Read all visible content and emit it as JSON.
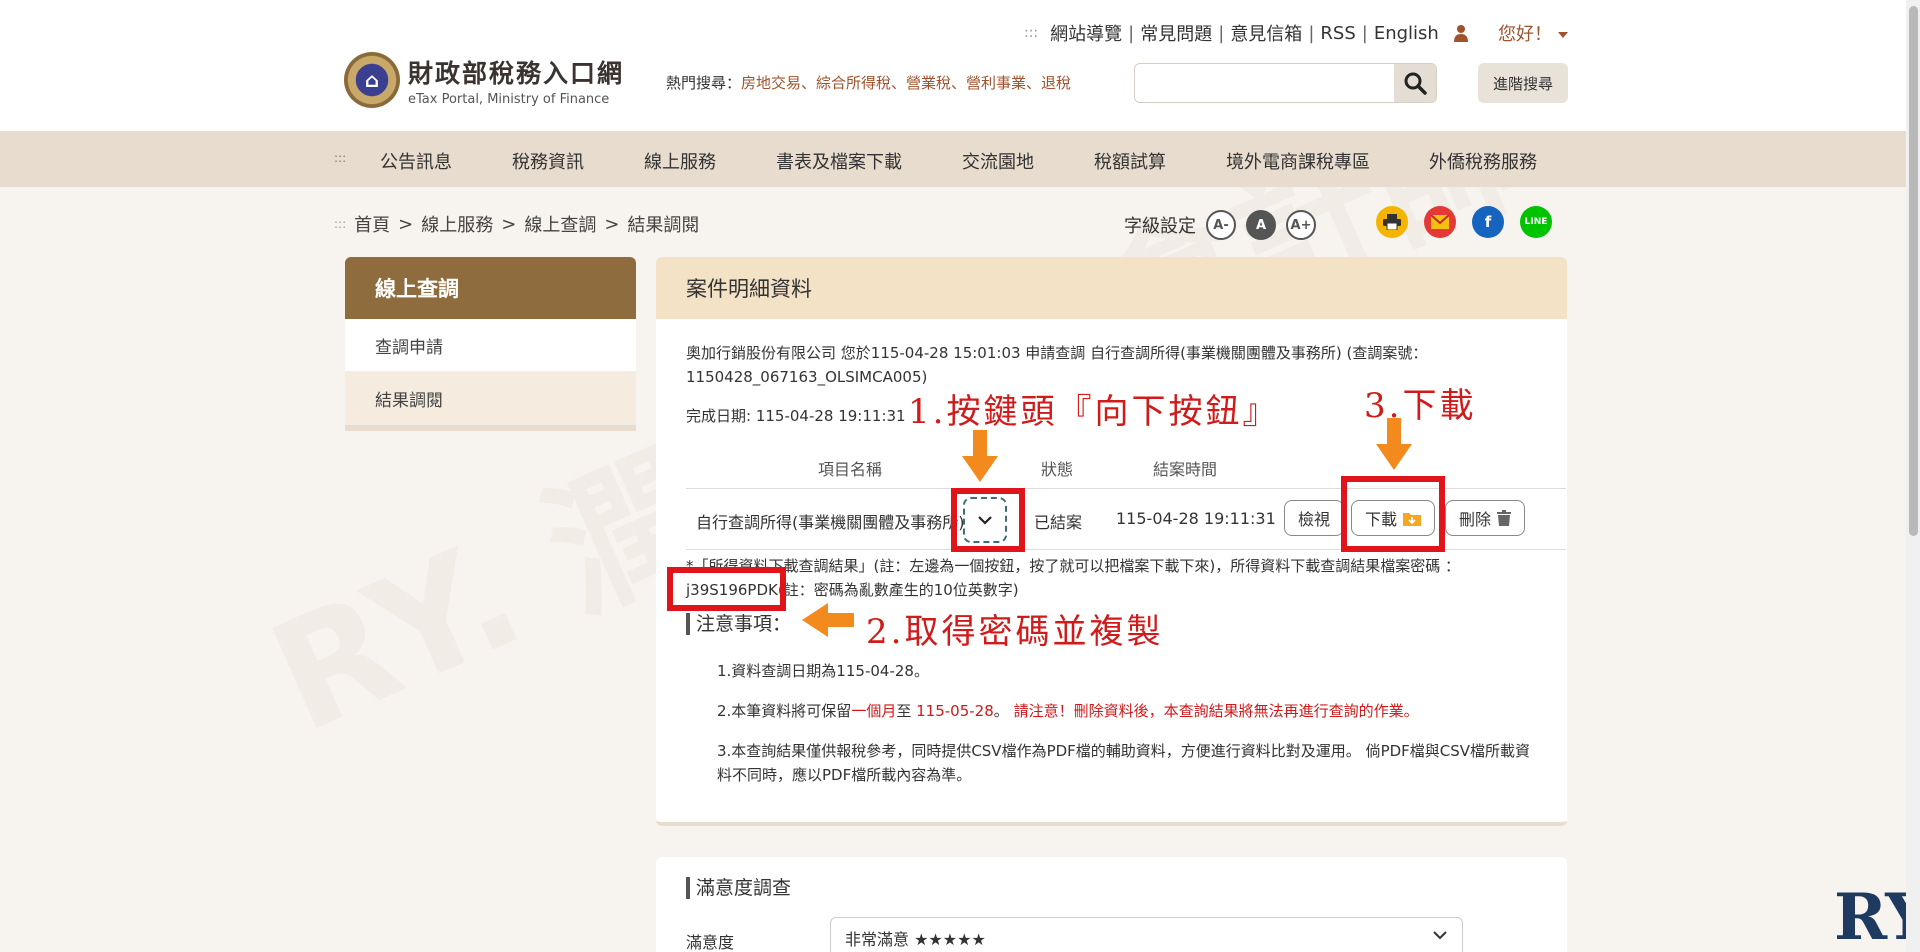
{
  "header": {
    "toplinks": [
      "網站導覽",
      "常見問題",
      "意見信箱",
      "RSS",
      "English"
    ],
    "greeting": "您好！",
    "logo_cn": "財政部稅務入口網",
    "logo_en": "eTax Portal, Ministry of Finance",
    "hot_label": "熱門搜尋：",
    "hot_keywords": "房地交易、綜合所得稅、營業稅、營利事業、退稅",
    "search_placeholder": "",
    "advanced_search": "進階搜尋"
  },
  "nav": {
    "items": [
      "公告訊息",
      "稅務資訊",
      "線上服務",
      "書表及檔案下載",
      "交流園地",
      "稅額試算",
      "境外電商課稅專區",
      "外僑稅務服務"
    ]
  },
  "breadcrumb": [
    "首頁",
    "線上服務",
    "線上查調",
    "結果調閱"
  ],
  "font_setting": {
    "label": "字級設定",
    "small": "A-",
    "normal": "A",
    "large": "A+"
  },
  "sidebar": {
    "title": "線上查調",
    "items": [
      "查調申請",
      "結果調閱"
    ]
  },
  "panel": {
    "title": "案件明細資料",
    "info": "奧加行銷股份有限公司 您於115-04-28 15:01:03 申請查調 自行查調所得(事業機關團體及事務所) (查調案號：1150428_067163_OLSIMCA005)",
    "completed": "完成日期: 115-04-28 19:11:31",
    "table_headers": [
      "項目名稱",
      "狀態",
      "結案時間"
    ],
    "row": {
      "name": "自行查調所得(事業機關團體及事務所)",
      "status": "已結案",
      "closed_time": "115-04-28 19:11:31",
      "view": "檢視",
      "download": "下載",
      "delete": "刪除"
    },
    "download_note": "*「所得資料下載查調結果」(註：左邊為一個按鈕，按了就可以把檔案下載下來)，所得資料下載查調結果檔案密碼 ：",
    "password": "j39S196PDK",
    "password_note": "(註：密碼為亂數產生的10位英數字)",
    "notice_title": "注意事項：",
    "notice1": "1.資料查調日期為115-04-28。",
    "notice2_a": "2.本筆資料將可保留",
    "notice2_b": "一個月",
    "notice2_c": "至",
    "notice2_d": "115-05-28",
    "notice2_e": "。",
    "notice2_f": "請注意！刪除資料後，本查詢結果將無法再進行查詢的作業。",
    "notice3": "3.本查詢結果僅供報稅參考，同時提供CSV檔作為PDF檔的輔助資料，方便進行資料比對及運用。 倘PDF檔與CSV檔所載資料不同時，應以PDF檔所載內容為準。"
  },
  "survey": {
    "title": "滿意度調查",
    "label": "滿意度",
    "selected": "非常滿意 ★★★★★"
  },
  "annotations": {
    "step1": "1.按鍵頭『向下按鈕』",
    "step2": "2.取得密碼並複製",
    "step3": "3.下載"
  },
  "colors": {
    "brown": "#8f6c3e",
    "nav_bg": "#e7dccd",
    "accent_red": "#d0191b",
    "annotation_red": "#e0141b",
    "arrow_orange": "#f28a1d"
  }
}
